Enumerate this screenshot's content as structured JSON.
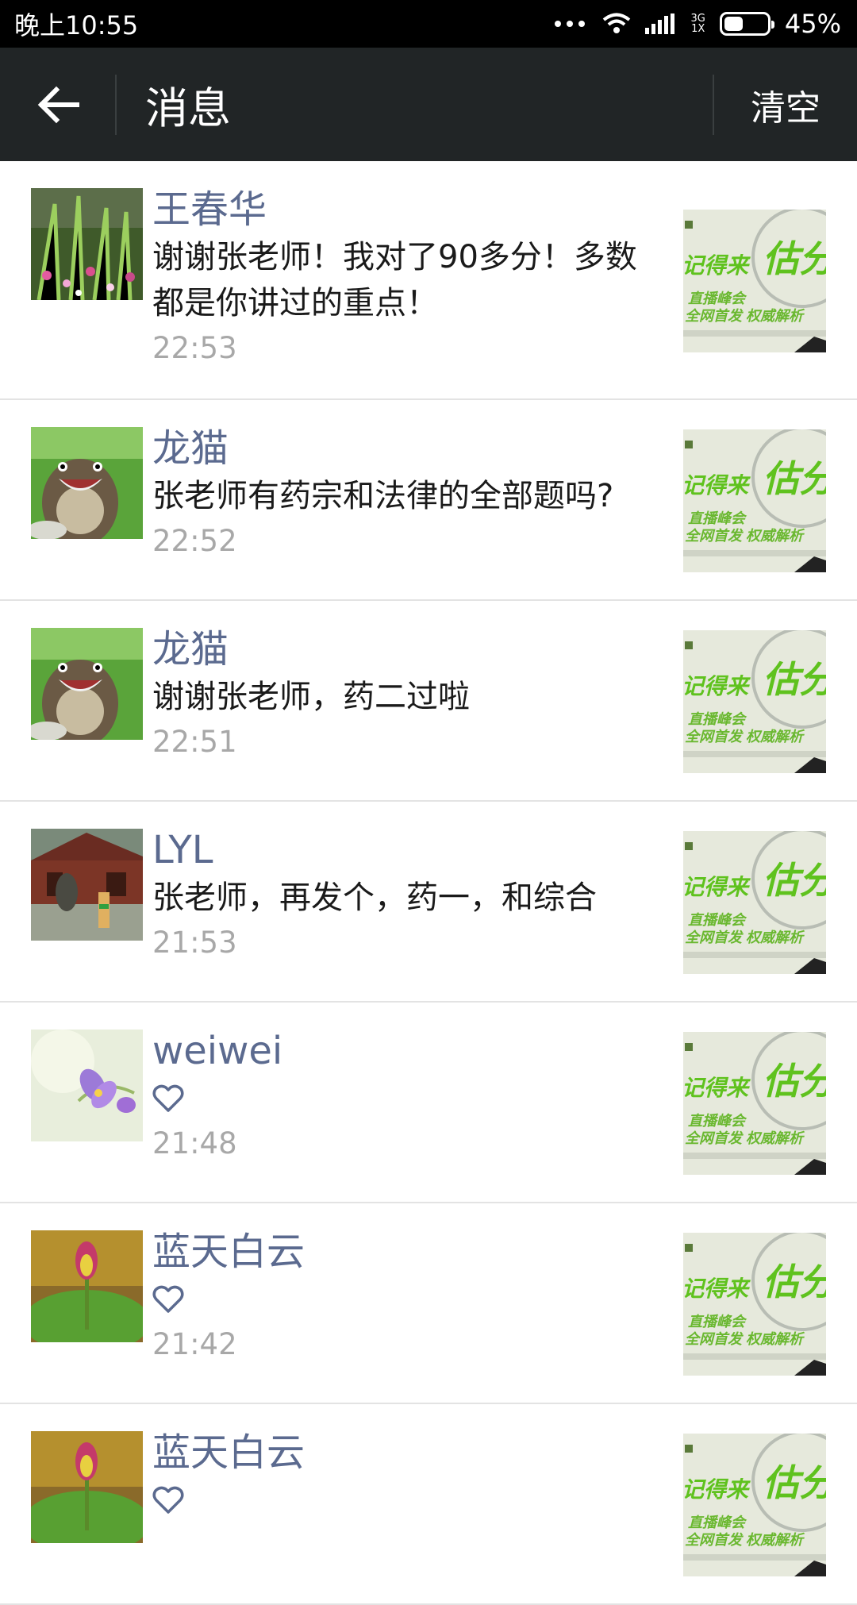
{
  "status_bar": {
    "time": "晚上10:55",
    "network_top": "3G",
    "network_bottom": "1X",
    "battery": "45%",
    "battery_level": 0.45
  },
  "header": {
    "back_icon": "arrow-left-icon",
    "title": "消息",
    "clear_label": "清空"
  },
  "thumbnail": {
    "text_main": "估分",
    "text_left": "记得来",
    "line1": "直播峰会",
    "line2": "全网首发 权威解析"
  },
  "messages": [
    {
      "sender": "王春华",
      "content": "谢谢张老师！我对了90多分！多数都是你讲过的重点！",
      "time": "22:53",
      "avatar": "garden"
    },
    {
      "sender": "龙猫",
      "content": "张老师有药宗和法律的全部题吗?",
      "time": "22:52",
      "avatar": "totoro"
    },
    {
      "sender": "龙猫",
      "content": "谢谢张老师，药二过啦",
      "time": "22:51",
      "avatar": "totoro"
    },
    {
      "sender": "LYL",
      "content": "张老师，再发个，药一，和综合",
      "time": "21:53",
      "avatar": "house"
    },
    {
      "sender": "weiwei",
      "content": "",
      "like": true,
      "time": "21:48",
      "avatar": "flower"
    },
    {
      "sender": "蓝天白云",
      "content": "",
      "like": true,
      "time": "21:42",
      "avatar": "lotus"
    },
    {
      "sender": "蓝天白云",
      "content": "",
      "like": true,
      "time": "",
      "avatar": "lotus"
    }
  ]
}
